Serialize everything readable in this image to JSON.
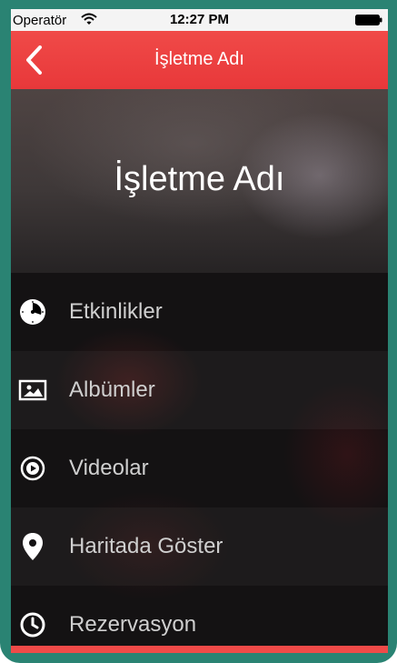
{
  "status_bar": {
    "carrier": "Operatör",
    "time": "12:27 PM"
  },
  "nav": {
    "title": "İşletme Adı",
    "back_icon": "chevron-left-icon"
  },
  "hero": {
    "title": "İşletme Adı"
  },
  "menu": {
    "items": [
      {
        "label": "Etkinlikler",
        "icon": "clock-icon"
      },
      {
        "label": "Albümler",
        "icon": "photo-album-icon"
      },
      {
        "label": "Videolar",
        "icon": "video-play-icon"
      },
      {
        "label": "Haritada Göster",
        "icon": "map-pin-icon"
      },
      {
        "label": "Rezervasyon",
        "icon": "clock-outline-icon"
      }
    ]
  },
  "colors": {
    "accent": "#f04a48",
    "frame": "#2a8373",
    "menu_text": "#cfcfcf"
  }
}
